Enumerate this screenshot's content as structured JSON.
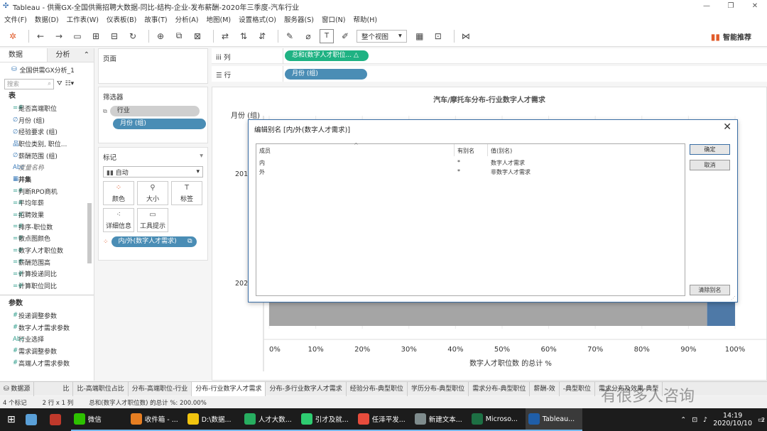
{
  "window": {
    "title": "Tableau - 供需GX-全国供需招聘大数据-同比-结构-企业-发布薪酬-2020年三季度-汽车行业",
    "controls": [
      "—",
      "❐",
      "✕"
    ]
  },
  "menu": [
    "文件(F)",
    "数据(D)",
    "工作表(W)",
    "仪表板(B)",
    "故事(T)",
    "分析(A)",
    "地图(M)",
    "设置格式(O)",
    "服务器(S)",
    "窗口(N)",
    "帮助(H)"
  ],
  "toolbar": {
    "fit_select": "整个视图",
    "smart_recommend": "智能推荐"
  },
  "datapane": {
    "tab_data": "数据",
    "tab_analysis": "分析",
    "datasource": "全国供需GX分析_1",
    "search_placeholder": "搜索",
    "tables_header": "表",
    "fields": [
      {
        "icon": "=#",
        "label": "是否高端职位",
        "style": "green"
      },
      {
        "icon": "∅",
        "label": "月份 (组)",
        "style": "blue"
      },
      {
        "icon": "∅",
        "label": "经验要求 (组)",
        "style": "blue"
      },
      {
        "icon": "品",
        "label": "职位类别, 职位...",
        "style": "blue"
      },
      {
        "icon": "∅",
        "label": "薪酬范围 (组)",
        "style": "blue"
      },
      {
        "icon": "Abc",
        "label": "度量名称",
        "style": "italic"
      },
      {
        "icon": "▦",
        "label": "井集",
        "style": "bold"
      },
      {
        "icon": "=#",
        "label": "判断RPO商机",
        "style": "green"
      },
      {
        "icon": "=#",
        "label": "平均年薪",
        "style": "green"
      },
      {
        "icon": "=#",
        "label": "招聘效果",
        "style": "green"
      },
      {
        "icon": "=#",
        "label": "排序-职位数",
        "style": "green"
      },
      {
        "icon": "=#",
        "label": "散点图颜色",
        "style": "green"
      },
      {
        "icon": "=#",
        "label": "数字人才职位数",
        "style": "green"
      },
      {
        "icon": "=#",
        "label": "薪酬范围高",
        "style": "green"
      },
      {
        "icon": "=#",
        "label": "计算投递同比",
        "style": "green"
      },
      {
        "icon": "=#",
        "label": "计算职位同比",
        "style": "green"
      }
    ],
    "params_header": "参数",
    "params": [
      {
        "icon": "#",
        "label": "投递调整参数"
      },
      {
        "icon": "#",
        "label": "数字人才需求参数"
      },
      {
        "icon": "Abc",
        "label": "行业选择"
      },
      {
        "icon": "#",
        "label": "需求调整参数"
      },
      {
        "icon": "#",
        "label": "高端人才需求参数"
      }
    ]
  },
  "pages": {
    "title": "页面"
  },
  "filters": {
    "title": "筛选器",
    "items": [
      "行业",
      "月份 (组)"
    ]
  },
  "marks": {
    "title": "标记",
    "type": "自动",
    "buttons": [
      "颜色",
      "大小",
      "标签",
      "详细信息",
      "工具提示"
    ],
    "pill": "内/外(数字人才需求)"
  },
  "shelves": {
    "columns_label": "列",
    "columns_pill": "总和(数字人才职位... △",
    "rows_label": "行",
    "rows_pill": "月份 (组)"
  },
  "viz": {
    "title": "汽车/摩托车分布-行业数字人才需求",
    "row_header": "月份 (组)",
    "row_label_1": "201",
    "row_label_2": "202",
    "x_ticks": [
      "0%",
      "10%",
      "20%",
      "30%",
      "40%",
      "50%",
      "60%",
      "70%",
      "80%",
      "90%",
      "100%"
    ],
    "x_label": "数字人才职位数 的总计 %",
    "colors": {
      "non_digital": "#a5a5a5",
      "digital": "#4e79a7"
    }
  },
  "chart_data": {
    "type": "bar",
    "title": "汽车/摩托车分布-行业数字人才需求",
    "xlabel": "数字人才职位数 的总计 %",
    "ylabel": "月份 (组)",
    "xlim": [
      0,
      100
    ],
    "series": [
      {
        "name": "非数字人才需求",
        "values": [
          94
        ]
      },
      {
        "name": "数字人才需求",
        "values": [
          6
        ]
      }
    ]
  },
  "dialog": {
    "title": "编辑别名 [内/外(数字人才需求)]",
    "col_member": "成员",
    "col_has_alias": "有别名",
    "col_value": "值(别名)",
    "rows": [
      {
        "member": "内",
        "has_alias": "*",
        "alias": "数字人才需求"
      },
      {
        "member": "外",
        "has_alias": "*",
        "alias": "非数字人才需求"
      }
    ],
    "ok": "确定",
    "cancel": "取消",
    "clear": "清除别名"
  },
  "sheettabs": {
    "datasource": "数据源",
    "tabs": [
      "比",
      "比-高端职位占比",
      "分布-高端职位-行业",
      "分布-行业数字人才需求",
      "分布-多行业数字人才需求",
      "经验分布-典型职位",
      "学历分布-典型职位",
      "需求分布-典型职位",
      "薪酬-效",
      "-典型职位",
      "需求分布及效果-典型"
    ]
  },
  "status": {
    "marks": "4 个标记",
    "rows_cols": "2 行 x 1 列",
    "sum": "总和(数字人才职位数) 的总计 %: 200.00%"
  },
  "taskbar": {
    "apps": [
      {
        "label": "",
        "color": "#5aa0d8"
      },
      {
        "label": "",
        "color": "#c0392b"
      },
      {
        "label": "微信",
        "color": "#2dc100"
      },
      {
        "label": "收件箱 - ...",
        "color": "#e67e22"
      },
      {
        "label": "D:\\数据...",
        "color": "#f1c40f"
      },
      {
        "label": "人才大数...",
        "color": "#27ae60"
      },
      {
        "label": "引才及就...",
        "color": "#2ecc71"
      },
      {
        "label": "任泽平发...",
        "color": "#e74c3c"
      },
      {
        "label": "新建文本...",
        "color": "#7f8c8d"
      },
      {
        "label": "Microso...",
        "color": "#1d7044"
      },
      {
        "label": "Tableau...",
        "color": "#1f5ea8"
      }
    ],
    "time": "14:19",
    "date": "2020/10/10",
    "notif_count": "2"
  },
  "watermark": "有很多人咨询"
}
